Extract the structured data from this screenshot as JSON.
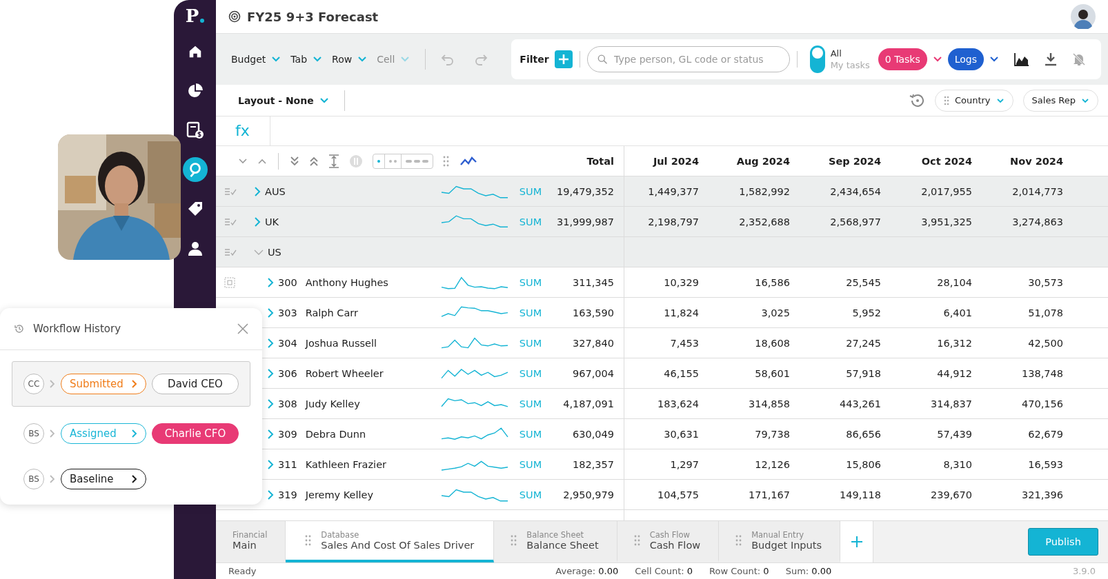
{
  "sidebar": {
    "logo": "P",
    "items": [
      {
        "selected": false
      },
      {
        "selected": false
      },
      {
        "selected": false
      },
      {
        "selected": true
      },
      {
        "selected": false
      },
      {
        "selected": false
      }
    ]
  },
  "header": {
    "title": "FY25 9+3 Forecast"
  },
  "toolbar": {
    "menus": [
      {
        "label": "Budget",
        "disabled": false
      },
      {
        "label": "Tab",
        "disabled": false
      },
      {
        "label": "Row",
        "disabled": false
      },
      {
        "label": "Cell",
        "disabled": true
      }
    ],
    "filter_label": "Filter",
    "search": {
      "placeholder": "Type person, GL code or status"
    },
    "task_toggle": [
      {
        "label": "All",
        "selected": true
      },
      {
        "label": "My tasks",
        "selected": false
      }
    ],
    "tasks_button": "0 Tasks",
    "logs_button": "Logs"
  },
  "layout_bar": {
    "layout": "Layout - None",
    "chips": [
      "Country",
      "Sales Rep"
    ]
  },
  "formula_bar": {
    "label": "fx"
  },
  "table": {
    "density": [
      {
        "selected": true
      },
      {
        "selected": false
      },
      {
        "selected": false
      }
    ],
    "columns": [
      "Total",
      "Jul 2024",
      "Aug 2024",
      "Sep 2024",
      "Oct 2024",
      "Nov 2024"
    ],
    "rows": [
      {
        "kind": "group",
        "label": "AUS",
        "expanded": false,
        "agg": "SUM",
        "total": "19,479,352",
        "values": [
          "1,449,377",
          "1,582,992",
          "2,434,654",
          "2,017,955",
          "2,014,773"
        ]
      },
      {
        "kind": "group",
        "label": "UK",
        "expanded": false,
        "agg": "SUM",
        "total": "31,999,987",
        "values": [
          "2,198,797",
          "2,352,688",
          "2,568,977",
          "3,951,325",
          "3,274,863"
        ]
      },
      {
        "kind": "group",
        "label": "US",
        "expanded": true
      },
      {
        "kind": "person",
        "code": "300",
        "label": "Anthony Hughes",
        "row_tool": true,
        "agg": "SUM",
        "total": "311,345",
        "values": [
          "10,329",
          "16,586",
          "25,545",
          "28,104",
          "30,573"
        ]
      },
      {
        "kind": "person",
        "code": "303",
        "label": "Ralph Carr",
        "agg": "SUM",
        "total": "163,590",
        "values": [
          "11,824",
          "3,025",
          "5,952",
          "6,401",
          "51,078"
        ]
      },
      {
        "kind": "person",
        "code": "304",
        "label": "Joshua Russell",
        "agg": "SUM",
        "total": "327,840",
        "values": [
          "7,453",
          "18,608",
          "27,245",
          "16,312",
          "42,500"
        ]
      },
      {
        "kind": "person",
        "code": "306",
        "label": "Robert Wheeler",
        "agg": "SUM",
        "total": "967,004",
        "values": [
          "46,155",
          "58,601",
          "57,918",
          "44,912",
          "138,748"
        ]
      },
      {
        "kind": "person",
        "code": "308",
        "label": "Judy Kelley",
        "agg": "SUM",
        "total": "4,187,091",
        "values": [
          "183,624",
          "314,858",
          "443,261",
          "314,837",
          "470,156"
        ]
      },
      {
        "kind": "person",
        "code": "309",
        "label": "Debra Dunn",
        "agg": "SUM",
        "total": "630,049",
        "values": [
          "30,631",
          "79,738",
          "86,656",
          "57,439",
          "62,679"
        ]
      },
      {
        "kind": "person",
        "code": "311",
        "label": "Kathleen Frazier",
        "agg": "SUM",
        "total": "182,357",
        "values": [
          "1,297",
          "12,126",
          "15,806",
          "8,310",
          "16,593"
        ]
      },
      {
        "kind": "person",
        "code": "319",
        "label": "Jeremy Kelley",
        "agg": "SUM",
        "total": "2,950,979",
        "values": [
          "104,575",
          "171,167",
          "149,118",
          "239,670",
          "321,396"
        ]
      }
    ]
  },
  "sheet_tabs": [
    {
      "group": "Financial",
      "label": "Main",
      "selected": false,
      "draggable": false
    },
    {
      "group": "Database",
      "label": "Sales And Cost Of Sales Driver",
      "selected": true,
      "draggable": true
    },
    {
      "group": "Balance Sheet",
      "label": "Balance Sheet",
      "selected": false,
      "draggable": true
    },
    {
      "group": "Cash Flow",
      "label": "Cash Flow",
      "selected": false,
      "draggable": true
    },
    {
      "group": "Manual Entry",
      "label": "Budget Inputs",
      "selected": false,
      "draggable": true
    }
  ],
  "publish_button": "Publish",
  "status_bar": {
    "state": "Ready",
    "metrics": [
      {
        "label": "Average:",
        "value": "0.00"
      },
      {
        "label": "Cell Count:",
        "value": "0"
      },
      {
        "label": "Row Count:",
        "value": "0"
      },
      {
        "label": "Sum:",
        "value": "0.00"
      }
    ],
    "version": "3.9.0"
  },
  "workflow_panel": {
    "title": "Workflow History",
    "entries": [
      {
        "initials": "CC",
        "status": "Submitted",
        "color": "#f07d1a",
        "assignee": "David CEO",
        "assignee_highlighted": false,
        "selected": true
      },
      {
        "initials": "BS",
        "status": "Assigned",
        "color": "#1ab6d6",
        "assignee": "Charlie CFO",
        "assignee_highlighted": true,
        "selected": false
      },
      {
        "initials": "BS",
        "status": "Baseline",
        "color": "#1a1a1a",
        "selected": false
      }
    ]
  }
}
